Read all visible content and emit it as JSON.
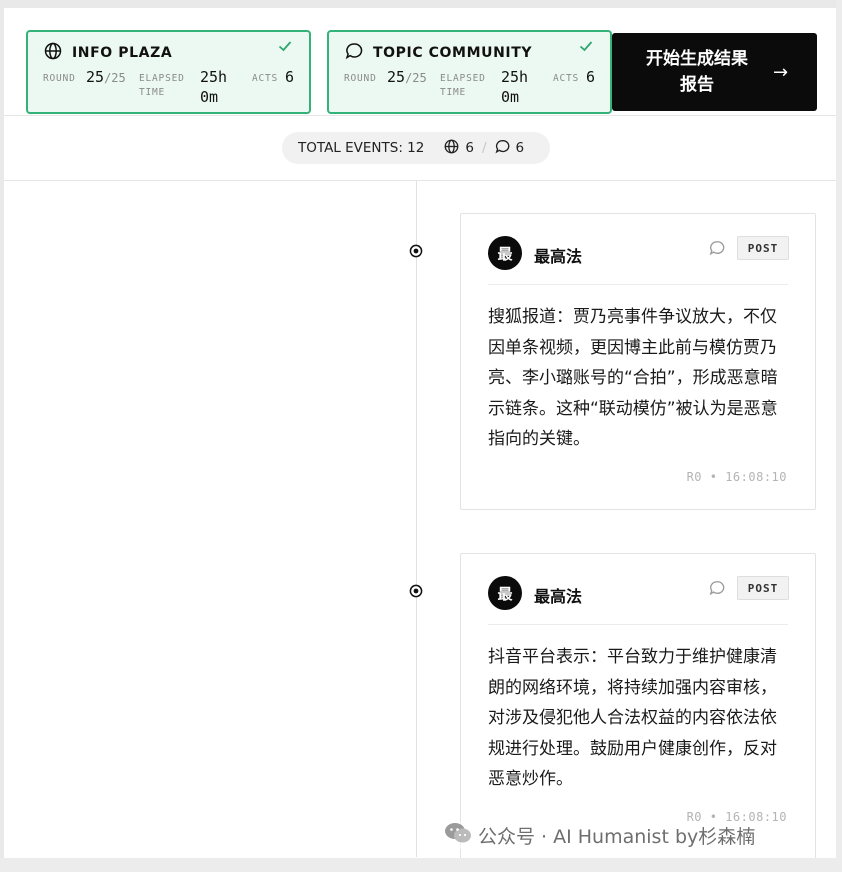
{
  "cards": [
    {
      "title": "INFO PLAZA",
      "icon": "globe-icon",
      "round_label": "ROUND",
      "round_value": "25",
      "round_total": "/25",
      "elapsed_label_1": "ELAPSED",
      "elapsed_label_2": "TIME",
      "elapsed_value_1": "25h",
      "elapsed_value_2": "0m",
      "acts_label": "ACTS",
      "acts_value": "6"
    },
    {
      "title": "TOPIC COMMUNITY",
      "icon": "chat-bubble-icon",
      "round_label": "ROUND",
      "round_value": "25",
      "round_total": "/25",
      "elapsed_label_1": "ELAPSED",
      "elapsed_label_2": "TIME",
      "elapsed_value_1": "25h",
      "elapsed_value_2": "0m",
      "acts_label": "ACTS",
      "acts_value": "6"
    }
  ],
  "report_button": {
    "label": "开始生成结果报告",
    "arrow": "→"
  },
  "events": {
    "total_label": "TOTAL EVENTS: 12",
    "plaza_count": "6",
    "topic_count": "6"
  },
  "posts": [
    {
      "avatar": "最",
      "author": "最高法",
      "badge": "POST",
      "content": "搜狐报道：贾乃亮事件争议放大，不仅因单条视频，更因博主此前与模仿贾乃亮、李小璐账号的“合拍”，形成恶意暗示链条。这种“联动模仿”被认为是恶意指向的关键。",
      "meta": "R0 • 16:08:10"
    },
    {
      "avatar": "最",
      "author": "最高法",
      "badge": "POST",
      "content": "抖音平台表示：平台致力于维护健康清朗的网络环境，将持续加强内容审核，对涉及侵犯他人合法权益的内容依法依规进行处理。鼓励用户健康创作，反对恶意炒作。",
      "meta": "R0 • 16:08:10"
    }
  ],
  "watermark": "公众号 · AI Humanist by杉森楠",
  "colors": {
    "card_border": "#33b27a",
    "card_bg": "#ecf9f2",
    "check": "#2ea56e",
    "button_bg": "#0b0b0b"
  }
}
